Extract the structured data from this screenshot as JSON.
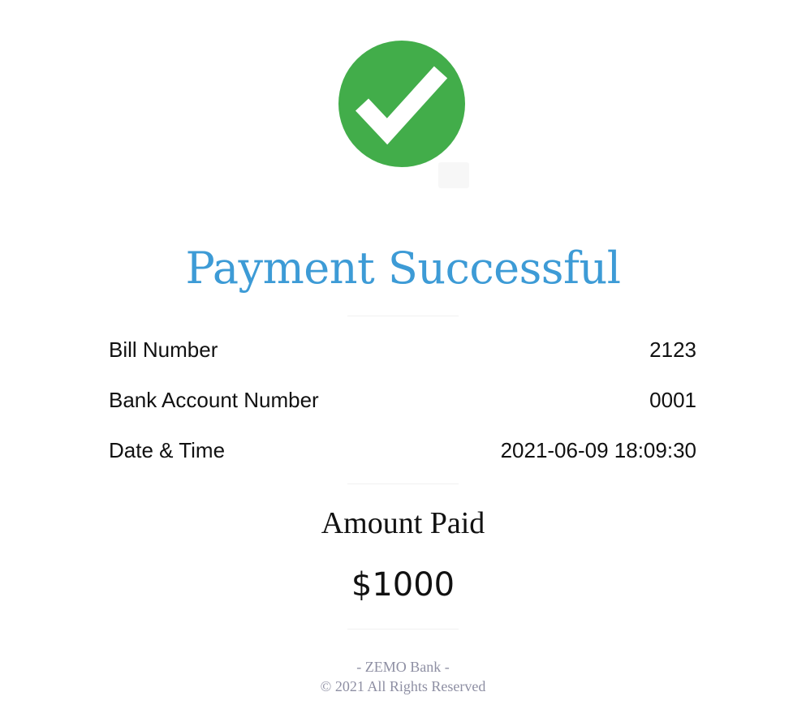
{
  "status": {
    "icon": "check-circle-icon",
    "icon_color": "#42ad4a",
    "title": "Payment Successful",
    "title_color": "#3d9bd6"
  },
  "details": {
    "rows": [
      {
        "label": "Bill Number",
        "value": "2123"
      },
      {
        "label": "Bank Account Number",
        "value": "0001"
      },
      {
        "label": "Date & Time",
        "value": "2021-06-09 18:09:30"
      }
    ]
  },
  "amount": {
    "label": "Amount Paid",
    "value": "$1000"
  },
  "footer": {
    "bank": "- ZEMO Bank -",
    "copyright": "© 2021 All Rights Reserved"
  }
}
